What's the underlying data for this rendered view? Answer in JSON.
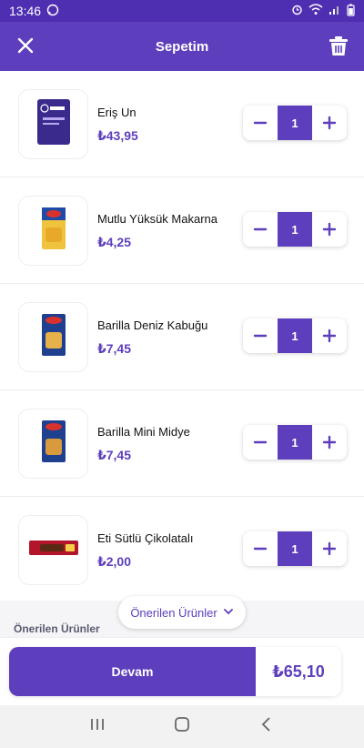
{
  "status_bar": {
    "time": "13:46"
  },
  "header": {
    "title": "Sepetim"
  },
  "cart": {
    "items": [
      {
        "name": "Eriş Un",
        "price": "₺43,95",
        "quantity": "1",
        "thumb_icon": "flour-bag-icon"
      },
      {
        "name": "Mutlu Yüksük Makarna",
        "price": "₺4,25",
        "quantity": "1",
        "thumb_icon": "pasta-box-icon"
      },
      {
        "name": "Barilla Deniz Kabuğu",
        "price": "₺7,45",
        "quantity": "1",
        "thumb_icon": "pasta-box-icon"
      },
      {
        "name": "Barilla Mini Midye",
        "price": "₺7,45",
        "quantity": "1",
        "thumb_icon": "pasta-box-icon"
      },
      {
        "name": "Eti Sütlü Çikolatalı",
        "price": "₺2,00",
        "quantity": "1",
        "thumb_icon": "chocolate-bar-icon"
      }
    ]
  },
  "suggestions": {
    "pill_label": "Önerilen Ürünler",
    "section_label": "Önerilen Ürünler"
  },
  "checkout": {
    "button_label": "Devam",
    "total": "₺65,10"
  },
  "colors": {
    "brand": "#5d3ebc",
    "status_bar": "#4f2fb1",
    "accent": "#5d3ebc"
  }
}
